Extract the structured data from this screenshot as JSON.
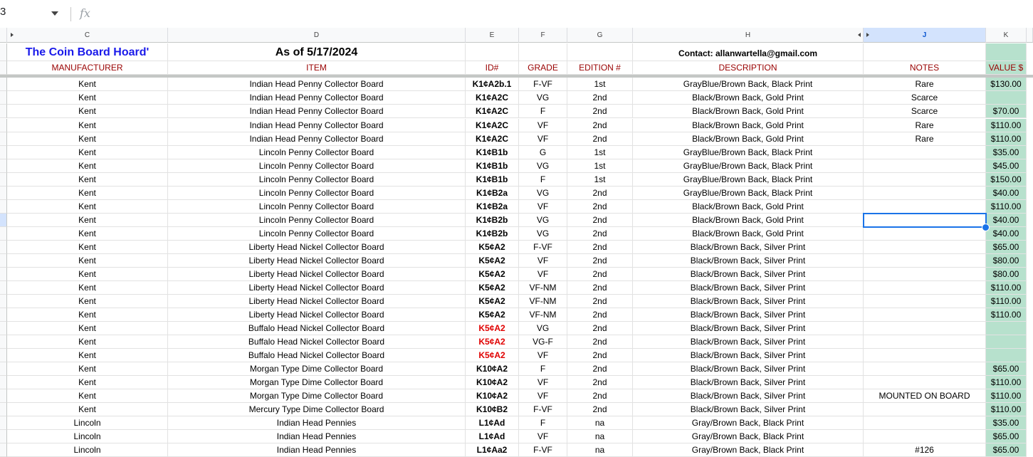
{
  "formula_bar": {
    "name_box": "3",
    "fx_label": "fx"
  },
  "columns": [
    {
      "letter": "C",
      "label_key": "manufacturer"
    },
    {
      "letter": "D"
    },
    {
      "letter": "E"
    },
    {
      "letter": "F"
    },
    {
      "letter": "G"
    },
    {
      "letter": "H"
    },
    {
      "letter": "J"
    },
    {
      "letter": "K"
    }
  ],
  "col_letters": [
    "C",
    "D",
    "E",
    "F",
    "G",
    "H",
    "J",
    "K"
  ],
  "titles": {
    "hoard": "The Coin Board Hoard'",
    "as_of": "As of 5/17/2024",
    "contact": "Contact: allanwartella@gmail.com"
  },
  "headers": [
    "MANUFACTURER",
    "ITEM",
    "ID#",
    "GRADE",
    "EDITION #",
    "DESCRIPTION",
    "NOTES",
    "VALUE $"
  ],
  "rows": [
    [
      "Kent",
      "Indian Head Penny Collector Board",
      "K1¢A2b.1",
      "F-VF",
      "1st",
      "GrayBlue/Brown Back, Black Print",
      "Rare",
      "$130.00"
    ],
    [
      "Kent",
      "Indian Head Penny Collector Board",
      "K1¢A2C",
      "VG",
      "2nd",
      "Black/Brown Back, Gold Print",
      "Scarce",
      ""
    ],
    [
      "Kent",
      "Indian Head Penny Collector Board",
      "K1¢A2C",
      "F",
      "2nd",
      "Black/Brown Back, Gold Print",
      "Scarce",
      "$70.00"
    ],
    [
      "Kent",
      "Indian Head Penny Collector Board",
      "K1¢A2C",
      "VF",
      "2nd",
      "Black/Brown Back, Gold Print",
      "Rare",
      "$110.00"
    ],
    [
      "Kent",
      "Indian Head Penny Collector Board",
      "K1¢A2C",
      "VF",
      "2nd",
      "Black/Brown Back, Gold Print",
      "Rare",
      "$110.00"
    ],
    [
      "Kent",
      "Lincoln Penny Collector Board",
      "K1¢B1b",
      "G",
      "1st",
      "GrayBlue/Brown Back, Black Print",
      "",
      "$35.00"
    ],
    [
      "Kent",
      "Lincoln Penny Collector Board",
      "K1¢B1b",
      "VG",
      "1st",
      "GrayBlue/Brown Back, Black Print",
      "",
      "$45.00"
    ],
    [
      "Kent",
      "Lincoln Penny Collector Board",
      "K1¢B1b",
      "F",
      "1st",
      "GrayBlue/Brown Back, Black Print",
      "",
      "$150.00"
    ],
    [
      "Kent",
      "Lincoln Penny Collector Board",
      "K1¢B2a",
      "VG",
      "2nd",
      "GrayBlue/Brown Back, Black Print",
      "",
      "$40.00"
    ],
    [
      "Kent",
      "Lincoln Penny Collector Board",
      "K1¢B2a",
      "VF",
      "2nd",
      "Black/Brown Back, Gold Print",
      "",
      "$110.00"
    ],
    [
      "Kent",
      "Lincoln Penny Collector Board",
      "K1¢B2b",
      "VG",
      "2nd",
      "Black/Brown Back, Gold Print",
      "",
      "$40.00"
    ],
    [
      "Kent",
      "Lincoln Penny Collector Board",
      "K1¢B2b",
      "VG",
      "2nd",
      "Black/Brown Back, Gold Print",
      "",
      "$40.00"
    ],
    [
      "Kent",
      "Liberty Head Nickel Collector Board",
      "K5¢A2",
      "F-VF",
      "2nd",
      "Black/Brown Back, Silver Print",
      "",
      "$65.00"
    ],
    [
      "Kent",
      "Liberty Head Nickel Collector Board",
      "K5¢A2",
      "VF",
      "2nd",
      "Black/Brown Back, Silver Print",
      "",
      "$80.00"
    ],
    [
      "Kent",
      "Liberty Head Nickel Collector Board",
      "K5¢A2",
      "VF",
      "2nd",
      "Black/Brown Back, Silver Print",
      "",
      "$80.00"
    ],
    [
      "Kent",
      "Liberty Head Nickel Collector Board",
      "K5¢A2",
      "VF-NM",
      "2nd",
      "Black/Brown Back, Silver Print",
      "",
      "$110.00"
    ],
    [
      "Kent",
      "Liberty Head Nickel Collector Board",
      "K5¢A2",
      "VF-NM",
      "2nd",
      "Black/Brown Back, Silver Print",
      "",
      "$110.00"
    ],
    [
      "Kent",
      "Liberty Head Nickel Collector Board",
      "K5¢A2",
      "VF-NM",
      "2nd",
      "Black/Brown Back, Silver Print",
      "",
      "$110.00"
    ],
    [
      "Kent",
      "Buffalo Head Nickel Collector Board",
      "K5¢A2",
      "VG",
      "2nd",
      "Black/Brown Back, Silver Print",
      "",
      ""
    ],
    [
      "Kent",
      "Buffalo Head Nickel Collector Board",
      "K5¢A2",
      "VG-F",
      "2nd",
      "Black/Brown Back, Silver Print",
      "",
      ""
    ],
    [
      "Kent",
      "Buffalo Head Nickel Collector Board",
      "K5¢A2",
      "VF",
      "2nd",
      "Black/Brown Back, Silver Print",
      "",
      ""
    ],
    [
      "Kent",
      "Morgan Type Dime Collector Board",
      "K10¢A2",
      "F",
      "2nd",
      "Black/Brown Back, Silver Print",
      "",
      "$65.00"
    ],
    [
      "Kent",
      "Morgan Type Dime Collector Board",
      "K10¢A2",
      "VF",
      "2nd",
      "Black/Brown Back, Silver Print",
      "",
      "$110.00"
    ],
    [
      "Kent",
      "Morgan Type Dime Collector Board",
      "K10¢A2",
      "VF",
      "2nd",
      "Black/Brown Back, Silver Print",
      "MOUNTED ON BOARD",
      "$110.00"
    ],
    [
      "Kent",
      "Mercury Type Dime Collector Board",
      "K10¢B2",
      "F-VF",
      "2nd",
      "Black/Brown Back, Silver Print",
      "",
      "$110.00"
    ],
    [
      "Lincoln",
      "Indian Head Pennies",
      "L1¢Ad",
      "F",
      "na",
      "Gray/Brown Back, Black Print",
      "",
      "$35.00"
    ],
    [
      "Lincoln",
      "Indian Head Pennies",
      "L1¢Ad",
      "VF",
      "na",
      "Gray/Brown Back, Black Print",
      "",
      "$65.00"
    ],
    [
      "Lincoln",
      "Indian Head Pennies",
      "L1¢Aa2",
      "F-VF",
      "na",
      "Gray/Brown Back, Black Print",
      "#126",
      "$65.00"
    ]
  ],
  "red_id_rows": [
    18,
    19,
    20
  ],
  "selected_row_index": 10,
  "colors": {
    "value_fill": "#b7e1cd",
    "header_red": "#990000",
    "title_blue": "#1a1aea",
    "selection": "#1a73e8"
  }
}
